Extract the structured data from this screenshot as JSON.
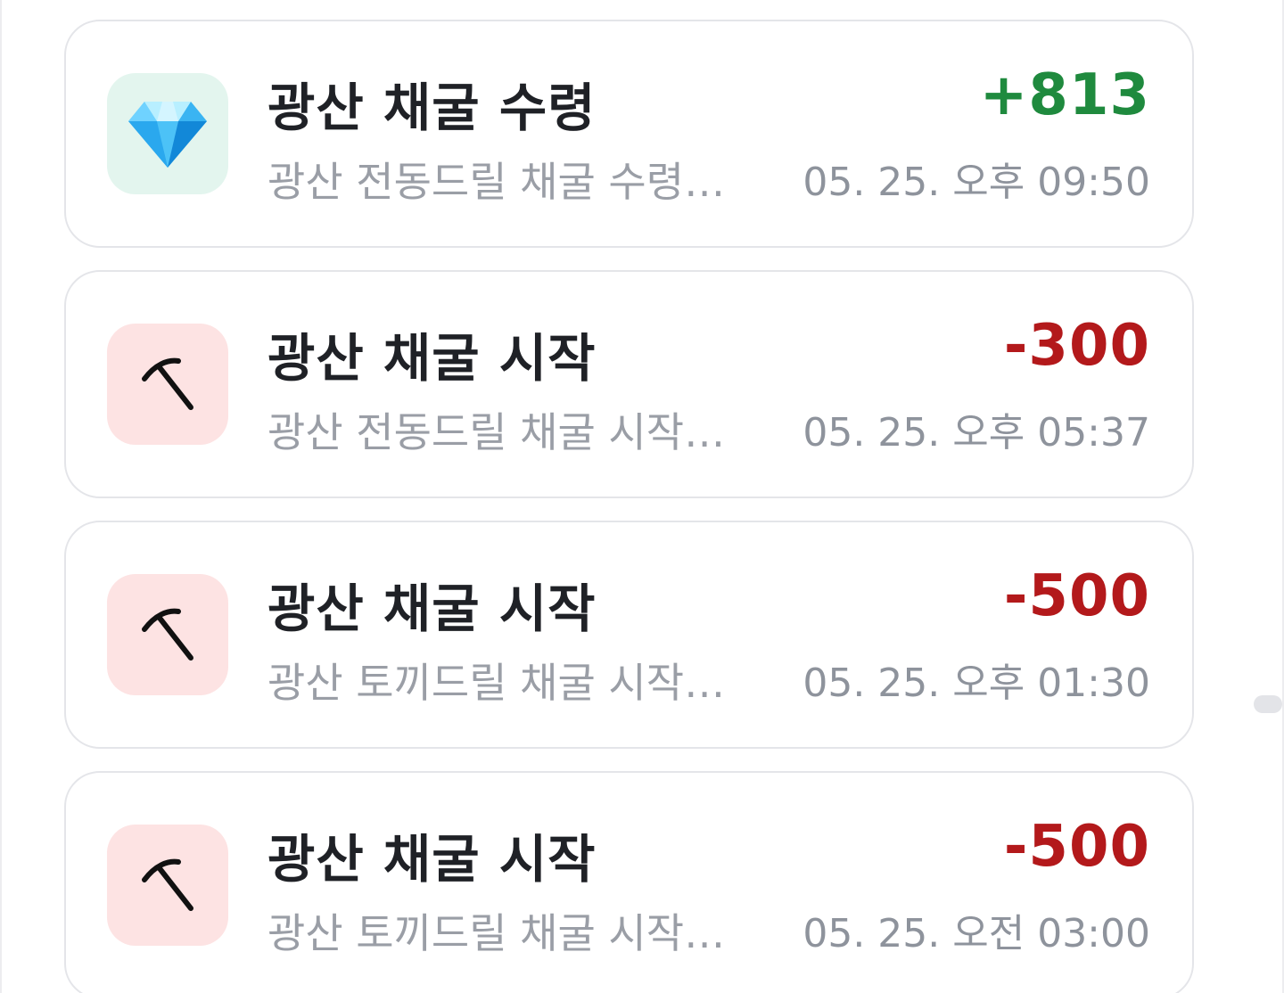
{
  "colors": {
    "positive": "#1f8a3e",
    "negative": "#b3191b",
    "gain_icon_bg": "#e3f5ee",
    "spend_icon_bg": "#fde3e3"
  },
  "transactions": [
    {
      "icon": "diamond-icon",
      "title": "광산 채굴 수령",
      "amount": "+813",
      "description": "광산 전동드릴 채굴 수령…",
      "time": "05. 25. 오후 09:50"
    },
    {
      "icon": "pickaxe-icon",
      "title": "광산 채굴 시작",
      "amount": "-300",
      "description": "광산 전동드릴 채굴 시작…",
      "time": "05. 25. 오후 05:37"
    },
    {
      "icon": "pickaxe-icon",
      "title": "광산 채굴 시작",
      "amount": "-500",
      "description": "광산 토끼드릴 채굴 시작…",
      "time": "05. 25. 오후 01:30"
    },
    {
      "icon": "pickaxe-icon",
      "title": "광산 채굴 시작",
      "amount": "-500",
      "description": "광산 토끼드릴 채굴 시작…",
      "time": "05. 25. 오전 03:00"
    }
  ]
}
